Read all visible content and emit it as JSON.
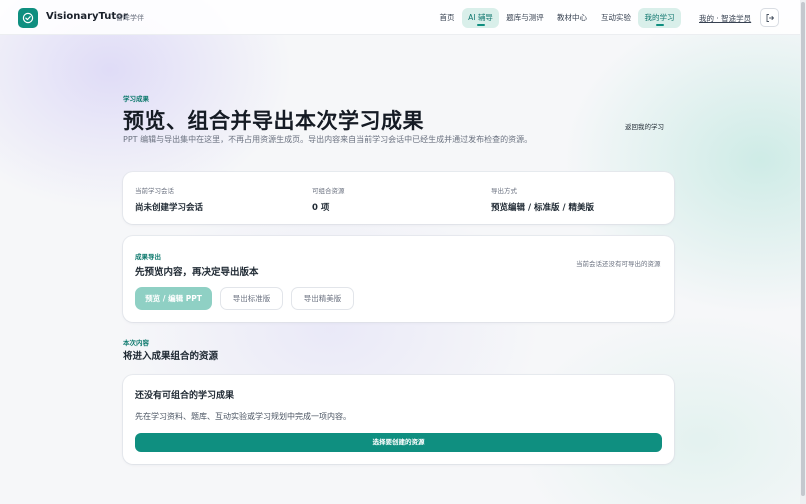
{
  "header": {
    "brand": "VisionaryTutor",
    "brand_sub": "智眸学伴",
    "nav": [
      {
        "label": "首页"
      },
      {
        "label": "AI 辅导"
      },
      {
        "label": "题库与测评"
      },
      {
        "label": "教材中心"
      },
      {
        "label": "互动实验"
      },
      {
        "label": "我的学习"
      }
    ],
    "user_link": "我的 · 智途学员",
    "icons": {
      "logo": "check-badge-icon",
      "logout": "logout-icon"
    },
    "accent_color": "#0f8f80"
  },
  "page": {
    "eyebrow": "学习成果",
    "title": "预览、组合并导出本次学习成果",
    "description": "PPT 编辑与导出集中在这里，不再占用资源生成页。导出内容来自当前学习会话中已经生成并通过发布检查的资源。",
    "back_link": "返回我的学习"
  },
  "summary": {
    "items": [
      {
        "label": "当前学习会话",
        "value": "尚未创建学习会话"
      },
      {
        "label": "可组合资源",
        "value": "0 项"
      },
      {
        "label": "导出方式",
        "value": "预览编辑 / 标准版 / 精美版"
      }
    ]
  },
  "export": {
    "eyebrow": "成果导出",
    "title": "先预览内容，再决定导出版本",
    "status": "当前会话还没有可导出的资源",
    "buttons": {
      "preview": "预览 / 编辑 PPT",
      "standard": "导出标准版",
      "premium": "导出精美版"
    }
  },
  "content": {
    "eyebrow": "本次内容",
    "title": "将进入成果组合的资源",
    "empty_title": "还没有可组合的学习成果",
    "empty_desc": "先在学习资料、题库、互动实验或学习规划中完成一项内容。",
    "cta": "选择要创建的资源"
  }
}
